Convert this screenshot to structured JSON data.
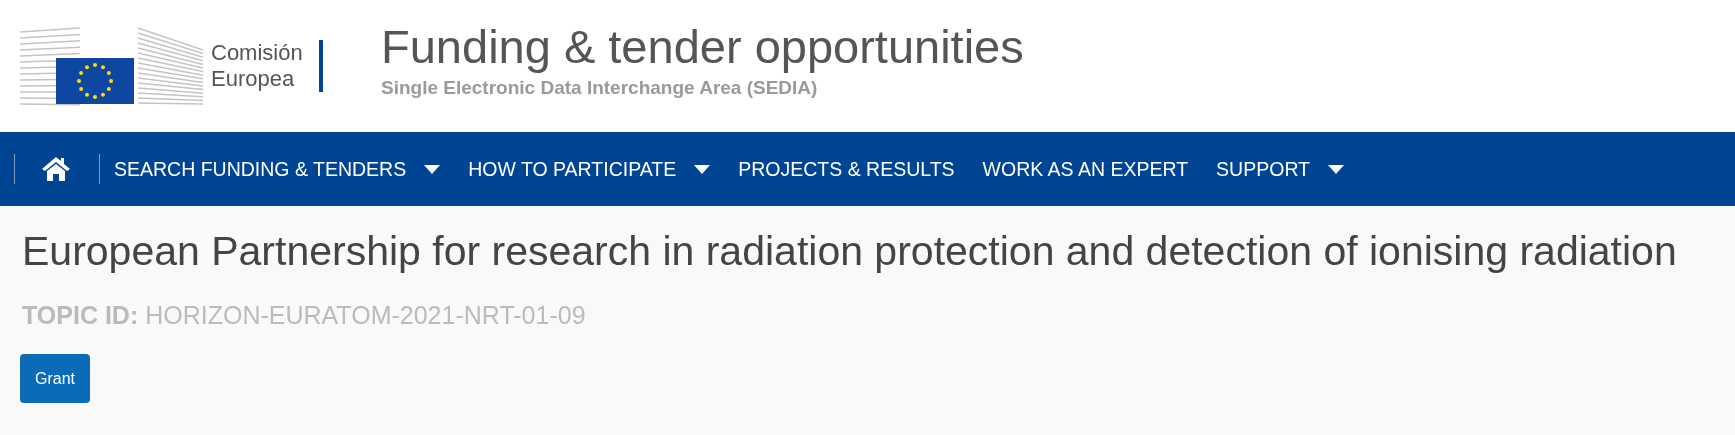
{
  "header": {
    "organisation": "Comisión Europea",
    "title": "Funding & tender opportunities",
    "subtitle": "Single Electronic Data Interchange Area (SEDIA)"
  },
  "nav": {
    "items": [
      {
        "label": "SEARCH FUNDING & TENDERS",
        "dropdown": true
      },
      {
        "label": "HOW TO PARTICIPATE",
        "dropdown": true
      },
      {
        "label": "PROJECTS & RESULTS",
        "dropdown": false
      },
      {
        "label": "WORK AS AN EXPERT",
        "dropdown": false
      },
      {
        "label": "SUPPORT",
        "dropdown": true
      }
    ]
  },
  "topic": {
    "title": "European Partnership for research in radiation protection and detection of ionising radiation",
    "id_label": "TOPIC ID:",
    "id": "HORIZON-EURATOM-2021-NRT-01-09",
    "type_button": "Grant"
  }
}
